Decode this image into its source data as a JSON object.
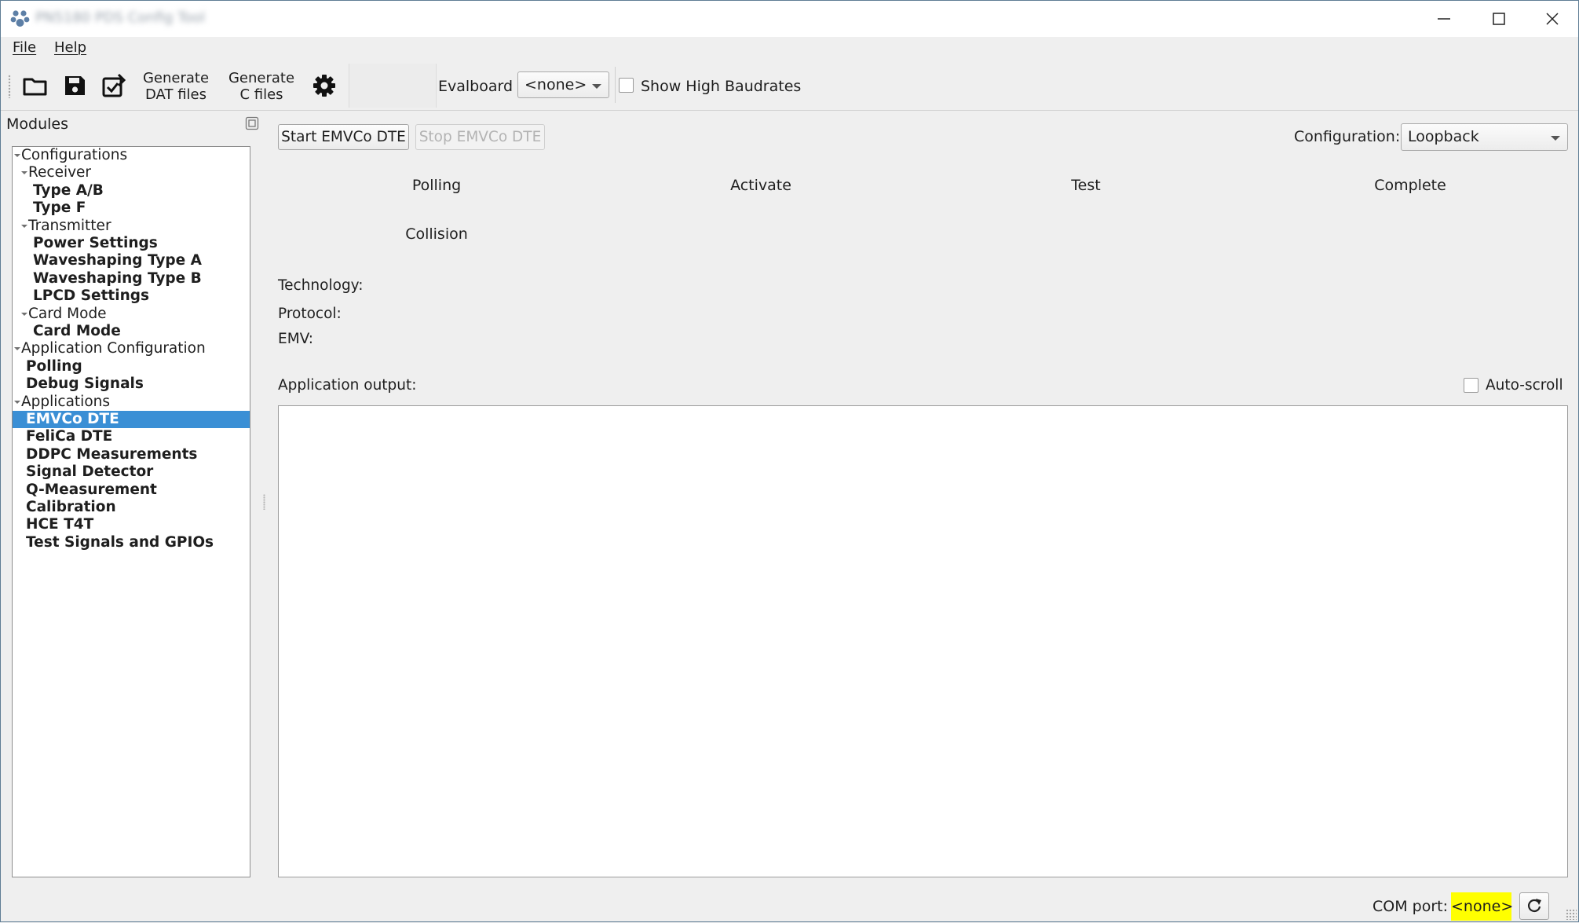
{
  "window": {
    "title": "PN5180 PDS Config Tool"
  },
  "menu": {
    "file": "File",
    "help": "Help"
  },
  "toolbar": {
    "open_icon": "folder-open-icon",
    "save_icon": "save-icon",
    "save_as_icon": "save-as-icon",
    "generate_dat": [
      "Generate",
      "DAT files"
    ],
    "generate_c": [
      "Generate",
      "C files"
    ],
    "settings_icon": "gear-icon",
    "evalboard_label": "Evalboard",
    "evalboard_value": "<none>",
    "high_baudrates_label": "Show High Baudrates"
  },
  "sidebar": {
    "title": "Modules",
    "tree": [
      {
        "label": "Configurations",
        "level": 0,
        "expandable": true,
        "bold": false
      },
      {
        "label": "Receiver",
        "level": 1,
        "expandable": true,
        "bold": false
      },
      {
        "label": "Type A/B",
        "level": 2,
        "expandable": false,
        "bold": true
      },
      {
        "label": "Type F",
        "level": 2,
        "expandable": false,
        "bold": true
      },
      {
        "label": "Transmitter",
        "level": 1,
        "expandable": true,
        "bold": false
      },
      {
        "label": "Power Settings",
        "level": 2,
        "expandable": false,
        "bold": true
      },
      {
        "label": "Waveshaping Type A",
        "level": 2,
        "expandable": false,
        "bold": true
      },
      {
        "label": "Waveshaping Type B",
        "level": 2,
        "expandable": false,
        "bold": true
      },
      {
        "label": "LPCD Settings",
        "level": 2,
        "expandable": false,
        "bold": true
      },
      {
        "label": "Card Mode",
        "level": 1,
        "expandable": true,
        "bold": false
      },
      {
        "label": "Card Mode",
        "level": 2,
        "expandable": false,
        "bold": true
      },
      {
        "label": "Application Configuration",
        "level": 0,
        "expandable": true,
        "bold": false
      },
      {
        "label": "Polling",
        "level": 1,
        "expandable": false,
        "bold": true
      },
      {
        "label": "Debug Signals",
        "level": 1,
        "expandable": false,
        "bold": true
      },
      {
        "label": "Applications",
        "level": 0,
        "expandable": true,
        "bold": false
      },
      {
        "label": "EMVCo DTE",
        "level": 1,
        "expandable": false,
        "bold": true,
        "selected": true
      },
      {
        "label": "FeliCa DTE",
        "level": 1,
        "expandable": false,
        "bold": true
      },
      {
        "label": "DDPC Measurements",
        "level": 1,
        "expandable": false,
        "bold": true
      },
      {
        "label": "Signal Detector",
        "level": 1,
        "expandable": false,
        "bold": true
      },
      {
        "label": "Q-Measurement",
        "level": 1,
        "expandable": false,
        "bold": true
      },
      {
        "label": "Calibration",
        "level": 1,
        "expandable": false,
        "bold": true
      },
      {
        "label": "HCE T4T",
        "level": 1,
        "expandable": false,
        "bold": true
      },
      {
        "label": "Test Signals and GPIOs",
        "level": 1,
        "expandable": false,
        "bold": true
      }
    ]
  },
  "main": {
    "start_button": "Start EMVCo DTE",
    "stop_button": "Stop EMVCo DTE",
    "configuration_label": "Configuration:",
    "configuration_value": "Loopback",
    "stages": {
      "polling": "Polling",
      "activate": "Activate",
      "test": "Test",
      "complete": "Complete",
      "collision": "Collision"
    },
    "technology_label": "Technology:",
    "protocol_label": "Protocol:",
    "emv_label": "EMV:",
    "output_label": "Application output:",
    "autoscroll_label": "Auto-scroll",
    "output_text": ""
  },
  "status": {
    "com_port_label": "COM port:",
    "com_port_value": "<none>",
    "refresh_icon": "refresh-icon"
  },
  "colors": {
    "selection": "#3a8fd5",
    "com_highlight": "#ffff00"
  }
}
